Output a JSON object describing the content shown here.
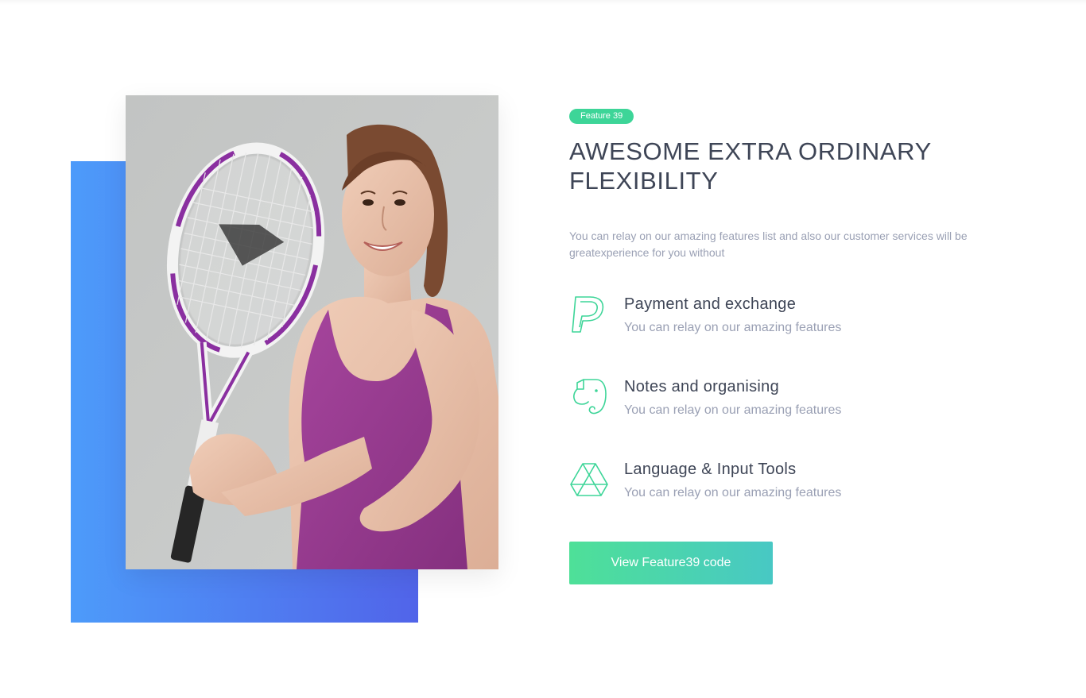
{
  "badge": "Feature 39",
  "title": "AWESOME EXTRA ORDINARY FLEXIBILITY",
  "subtitle": "You can relay on our amazing features list and also our customer services will be greatexperience for you without",
  "features": [
    {
      "icon": "paypal-icon",
      "title": "Payment and exchange",
      "description": "You can relay on our amazing features"
    },
    {
      "icon": "evernote-icon",
      "title": "Notes and organising",
      "description": "You can relay on our amazing features"
    },
    {
      "icon": "google-drive-icon",
      "title": "Language & Input Tools",
      "description": "You can relay on our amazing features"
    }
  ],
  "cta_label": "View Feature39 code",
  "colors": {
    "accent": "#3dd598",
    "heading": "#3e4556",
    "muted": "#9aa0b4",
    "blue_block_start": "#4d9bfa",
    "blue_block_end": "#5164e9",
    "cta_start": "#4ee098",
    "cta_end": "#48c8c4"
  },
  "image": {
    "subject": "woman holding tennis racket and ball"
  }
}
